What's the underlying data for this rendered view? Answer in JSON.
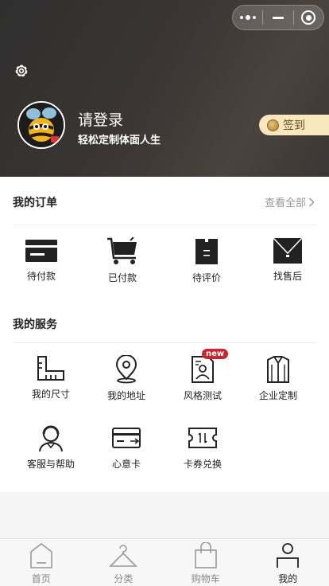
{
  "user": {
    "login_title": "请登录",
    "slogan": "轻松定制体面人生",
    "sign_in_label": "签到",
    "avatar_icon": "bee-mascot-avatar",
    "settings_icon": "gear-icon"
  },
  "miniapp_capsule": {
    "more_icon": "more-dots-icon",
    "minimize_icon": "minus-icon",
    "close_icon": "target-close-icon"
  },
  "orders": {
    "title": "我的订单",
    "view_all": "查看全部",
    "items": [
      {
        "label": "待付款",
        "icon": "wallet-icon"
      },
      {
        "label": "已付款",
        "icon": "cart-icon"
      },
      {
        "label": "待评价",
        "icon": "shopping-bag-icon"
      },
      {
        "label": "找售后",
        "icon": "envelope-icon"
      }
    ]
  },
  "services": {
    "title": "我的服务",
    "new_badge": "new",
    "items": [
      {
        "label": "我的尺寸",
        "icon": "ruler-icon"
      },
      {
        "label": "我的地址",
        "icon": "location-pin-icon"
      },
      {
        "label": "风格测试",
        "icon": "style-test-icon"
      },
      {
        "label": "企业定制",
        "icon": "shirt-icon"
      },
      {
        "label": "客服与帮助",
        "icon": "headset-agent-icon"
      },
      {
        "label": "心意卡",
        "icon": "card-icon"
      },
      {
        "label": "卡券兑换",
        "icon": "ticket-icon"
      }
    ]
  },
  "tabbar": {
    "tabs": [
      {
        "label": "首页",
        "icon": "home-icon"
      },
      {
        "label": "分类",
        "icon": "hanger-icon"
      },
      {
        "label": "购物车",
        "icon": "bag-icon"
      },
      {
        "label": "我的",
        "icon": "person-icon"
      }
    ],
    "active_index": 3
  },
  "colors": {
    "header_dark": "#3a3533",
    "sign_in_bg": "#f8e7bd",
    "badge_red": "#c5282f"
  }
}
